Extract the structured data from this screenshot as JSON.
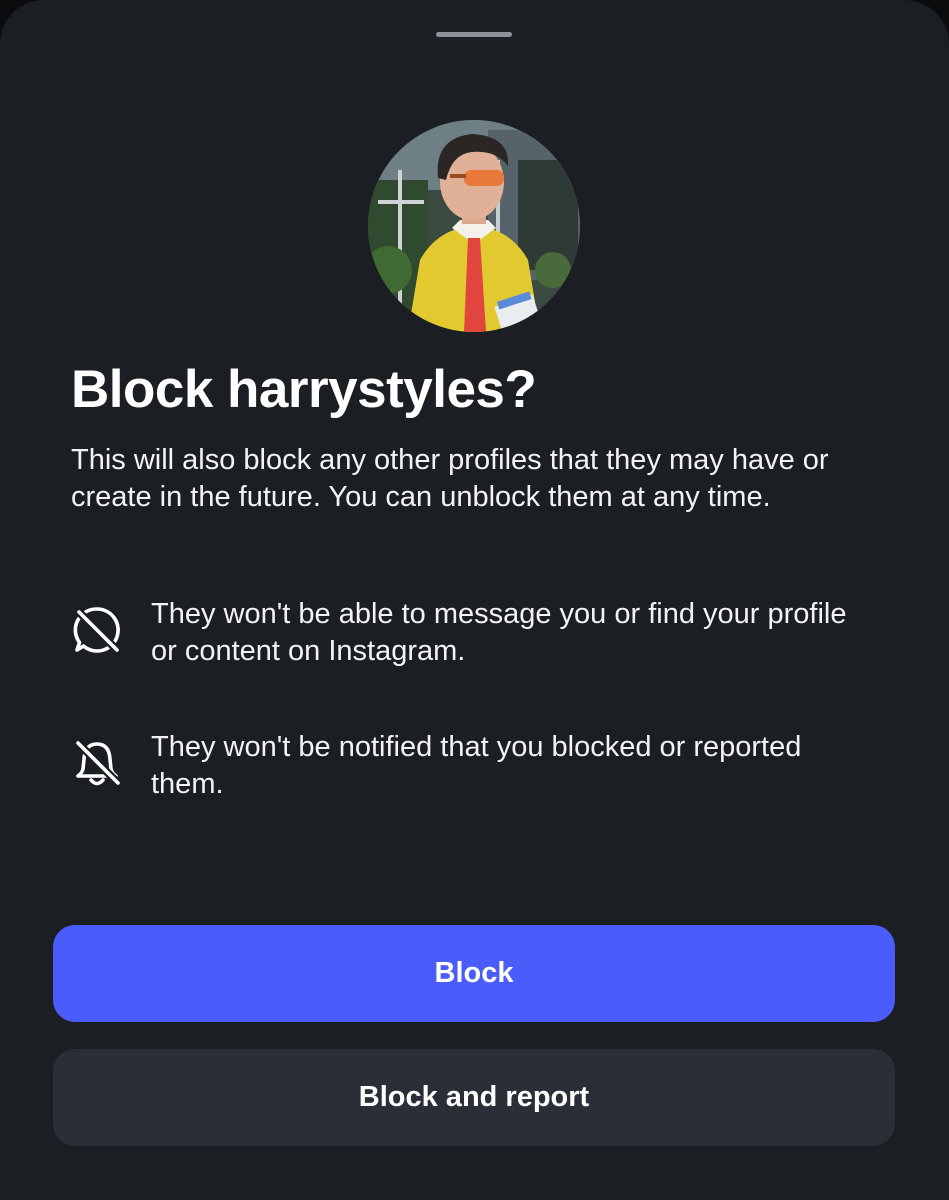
{
  "sheet": {
    "title": "Block harrystyles?",
    "description": "This will also block any other profiles that they may have or create in the future. You can unblock them at any time.",
    "avatar_alt": "profile-photo"
  },
  "info_items": [
    {
      "icon": "no-message-icon",
      "text": "They won't be able to message you or find your profile or content on Instagram."
    },
    {
      "icon": "notifications-off-icon",
      "text": "They won't be notified that you blocked or reported them."
    }
  ],
  "actions": {
    "block_label": "Block",
    "block_report_label": "Block and report"
  },
  "colors": {
    "sheet_background": "#1b1e22",
    "primary_button": "#4a5dfa",
    "secondary_button": "#2a2f37",
    "text": "#ffffff"
  }
}
